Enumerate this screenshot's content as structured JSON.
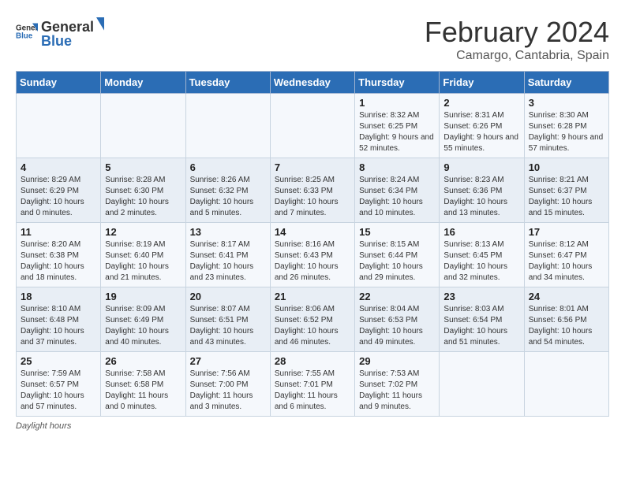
{
  "header": {
    "logo_general": "General",
    "logo_blue": "Blue",
    "month_title": "February 2024",
    "location": "Camargo, Cantabria, Spain"
  },
  "days_of_week": [
    "Sunday",
    "Monday",
    "Tuesday",
    "Wednesday",
    "Thursday",
    "Friday",
    "Saturday"
  ],
  "weeks": [
    [
      {
        "day": "",
        "info": ""
      },
      {
        "day": "",
        "info": ""
      },
      {
        "day": "",
        "info": ""
      },
      {
        "day": "",
        "info": ""
      },
      {
        "day": "1",
        "info": "Sunrise: 8:32 AM\nSunset: 6:25 PM\nDaylight: 9 hours and 52 minutes."
      },
      {
        "day": "2",
        "info": "Sunrise: 8:31 AM\nSunset: 6:26 PM\nDaylight: 9 hours and 55 minutes."
      },
      {
        "day": "3",
        "info": "Sunrise: 8:30 AM\nSunset: 6:28 PM\nDaylight: 9 hours and 57 minutes."
      }
    ],
    [
      {
        "day": "4",
        "info": "Sunrise: 8:29 AM\nSunset: 6:29 PM\nDaylight: 10 hours and 0 minutes."
      },
      {
        "day": "5",
        "info": "Sunrise: 8:28 AM\nSunset: 6:30 PM\nDaylight: 10 hours and 2 minutes."
      },
      {
        "day": "6",
        "info": "Sunrise: 8:26 AM\nSunset: 6:32 PM\nDaylight: 10 hours and 5 minutes."
      },
      {
        "day": "7",
        "info": "Sunrise: 8:25 AM\nSunset: 6:33 PM\nDaylight: 10 hours and 7 minutes."
      },
      {
        "day": "8",
        "info": "Sunrise: 8:24 AM\nSunset: 6:34 PM\nDaylight: 10 hours and 10 minutes."
      },
      {
        "day": "9",
        "info": "Sunrise: 8:23 AM\nSunset: 6:36 PM\nDaylight: 10 hours and 13 minutes."
      },
      {
        "day": "10",
        "info": "Sunrise: 8:21 AM\nSunset: 6:37 PM\nDaylight: 10 hours and 15 minutes."
      }
    ],
    [
      {
        "day": "11",
        "info": "Sunrise: 8:20 AM\nSunset: 6:38 PM\nDaylight: 10 hours and 18 minutes."
      },
      {
        "day": "12",
        "info": "Sunrise: 8:19 AM\nSunset: 6:40 PM\nDaylight: 10 hours and 21 minutes."
      },
      {
        "day": "13",
        "info": "Sunrise: 8:17 AM\nSunset: 6:41 PM\nDaylight: 10 hours and 23 minutes."
      },
      {
        "day": "14",
        "info": "Sunrise: 8:16 AM\nSunset: 6:43 PM\nDaylight: 10 hours and 26 minutes."
      },
      {
        "day": "15",
        "info": "Sunrise: 8:15 AM\nSunset: 6:44 PM\nDaylight: 10 hours and 29 minutes."
      },
      {
        "day": "16",
        "info": "Sunrise: 8:13 AM\nSunset: 6:45 PM\nDaylight: 10 hours and 32 minutes."
      },
      {
        "day": "17",
        "info": "Sunrise: 8:12 AM\nSunset: 6:47 PM\nDaylight: 10 hours and 34 minutes."
      }
    ],
    [
      {
        "day": "18",
        "info": "Sunrise: 8:10 AM\nSunset: 6:48 PM\nDaylight: 10 hours and 37 minutes."
      },
      {
        "day": "19",
        "info": "Sunrise: 8:09 AM\nSunset: 6:49 PM\nDaylight: 10 hours and 40 minutes."
      },
      {
        "day": "20",
        "info": "Sunrise: 8:07 AM\nSunset: 6:51 PM\nDaylight: 10 hours and 43 minutes."
      },
      {
        "day": "21",
        "info": "Sunrise: 8:06 AM\nSunset: 6:52 PM\nDaylight: 10 hours and 46 minutes."
      },
      {
        "day": "22",
        "info": "Sunrise: 8:04 AM\nSunset: 6:53 PM\nDaylight: 10 hours and 49 minutes."
      },
      {
        "day": "23",
        "info": "Sunrise: 8:03 AM\nSunset: 6:54 PM\nDaylight: 10 hours and 51 minutes."
      },
      {
        "day": "24",
        "info": "Sunrise: 8:01 AM\nSunset: 6:56 PM\nDaylight: 10 hours and 54 minutes."
      }
    ],
    [
      {
        "day": "25",
        "info": "Sunrise: 7:59 AM\nSunset: 6:57 PM\nDaylight: 10 hours and 57 minutes."
      },
      {
        "day": "26",
        "info": "Sunrise: 7:58 AM\nSunset: 6:58 PM\nDaylight: 11 hours and 0 minutes."
      },
      {
        "day": "27",
        "info": "Sunrise: 7:56 AM\nSunset: 7:00 PM\nDaylight: 11 hours and 3 minutes."
      },
      {
        "day": "28",
        "info": "Sunrise: 7:55 AM\nSunset: 7:01 PM\nDaylight: 11 hours and 6 minutes."
      },
      {
        "day": "29",
        "info": "Sunrise: 7:53 AM\nSunset: 7:02 PM\nDaylight: 11 hours and 9 minutes."
      },
      {
        "day": "",
        "info": ""
      },
      {
        "day": "",
        "info": ""
      }
    ]
  ],
  "footer": {
    "label": "Daylight hours"
  }
}
